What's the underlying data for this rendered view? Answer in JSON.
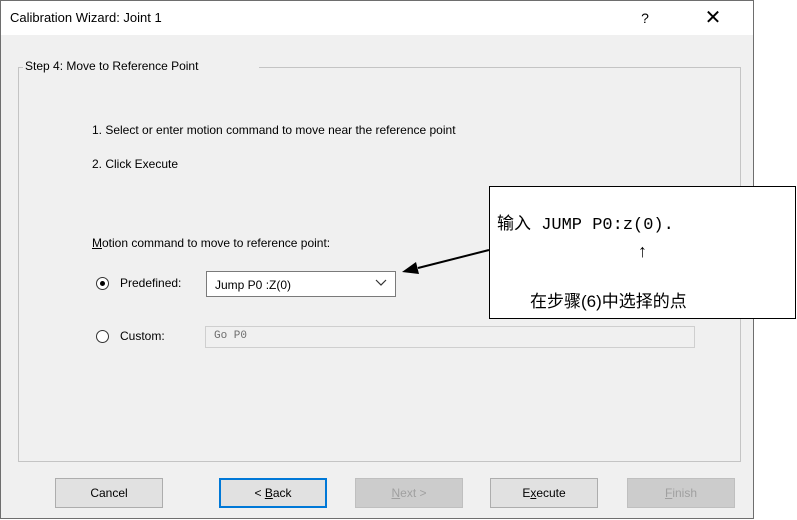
{
  "window": {
    "title": "Calibration Wizard: Joint 1",
    "help_glyph": "?",
    "close_glyph": "✕"
  },
  "step": {
    "title": "Step 4: Move to Reference Point",
    "instruction_1": "1. Select or enter motion command to move near the reference point",
    "instruction_2": "2. Click Execute"
  },
  "motion": {
    "label_underlined": "M",
    "label_rest": "otion command to move to reference point:",
    "predefined_label": "Predefined:",
    "predefined_selected": true,
    "predefined_value": "Jump P0 :Z(0)",
    "custom_label": "Custom:",
    "custom_selected": false,
    "custom_value": "Go P0"
  },
  "buttons": {
    "cancel": "Cancel",
    "back_pre": "< ",
    "back_ul": "B",
    "back_post": "ack",
    "next_ul": "N",
    "next_post": "ext >",
    "execute_pre": "E",
    "execute_ul": "x",
    "execute_post": "ecute",
    "finish_ul": "F",
    "finish_post": "inish"
  },
  "callout": {
    "prefix": "输入",
    "command": " JUMP P0:z(0).",
    "arrow": "↑",
    "note": "在步骤(6)中选择的点"
  },
  "colors": {
    "dialog_bg": "#f0f0f0",
    "focus_border": "#0078d7",
    "disabled_text": "#a0a0a0"
  }
}
